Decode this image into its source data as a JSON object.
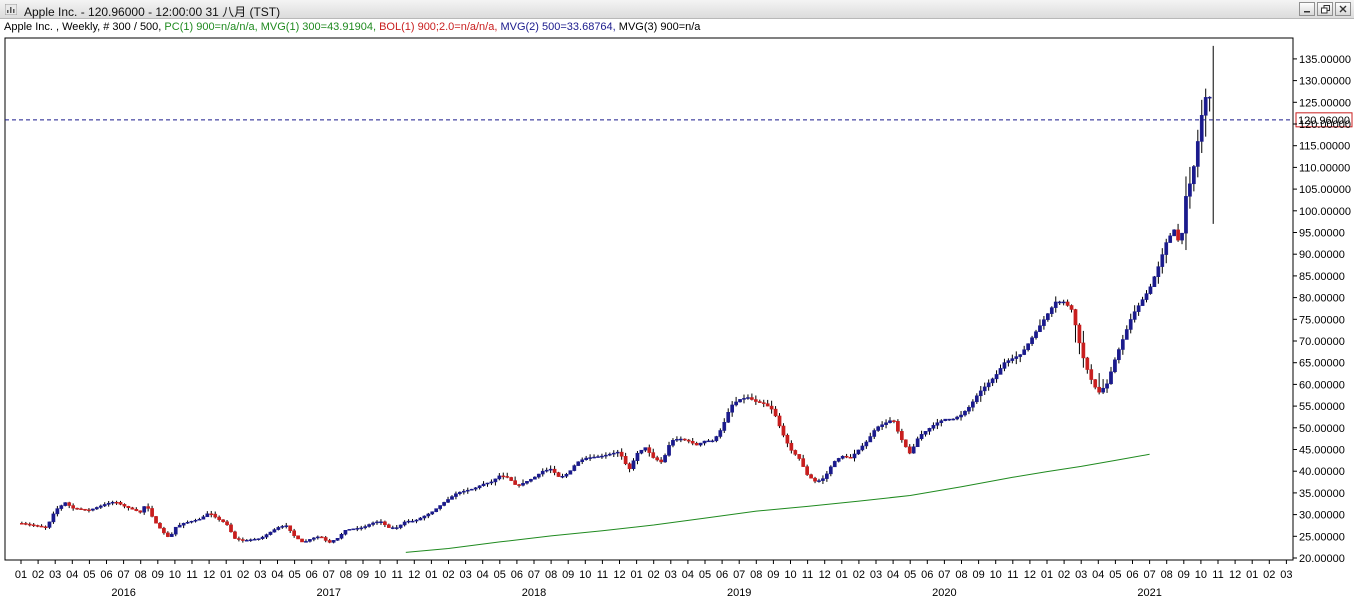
{
  "window": {
    "title": "Apple Inc. - 120.96000 - 12:00:00  31 八月 (TST)",
    "controls": [
      "minimize-icon",
      "restore-icon",
      "close-icon"
    ]
  },
  "infobar": {
    "symbol": "Apple Inc. , Weekly, # 300 / 500, ",
    "pc": "PC(1) 900=n/a/n/a, ",
    "mvg1": "MVG(1) 300=43.91904, ",
    "bol": "BOL(1) 900;2.0=n/a/n/a, ",
    "mvg2": "MVG(2) 500=33.68764, ",
    "mvg3": "MVG(3) 900=n/a"
  },
  "colors": {
    "up": "#1a1a8c",
    "down": "#c81e1e",
    "pc": "#1f8a1f",
    "mvg1": "#1f8a1f",
    "bol": "#c81e1e",
    "mvg2": "#1a1a8c",
    "mvg3": "#000000",
    "grid": "#e2e2e2",
    "current_line": "#1a1a8c",
    "current_box": "#c81e1e"
  },
  "chart_data": {
    "type": "candlestick",
    "current_price": 120.96,
    "current_price_label": "120.96000",
    "y_ticks": [
      "20.00000",
      "25.00000",
      "30.00000",
      "35.00000",
      "40.00000",
      "45.00000",
      "50.00000",
      "55.00000",
      "60.00000",
      "65.00000",
      "70.00000",
      "75.00000",
      "80.00000",
      "85.00000",
      "90.00000",
      "95.00000",
      "100.00000",
      "105.00000",
      "110.00000",
      "115.00000",
      "120.00000",
      "125.00000",
      "130.00000",
      "135.00000"
    ],
    "ylim": [
      19.5,
      139.5
    ],
    "x_month_labels": [
      "01",
      "02",
      "03",
      "04",
      "05",
      "06",
      "07",
      "08",
      "09",
      "10",
      "11",
      "12",
      "01",
      "02",
      "03",
      "04",
      "05",
      "06",
      "07",
      "08",
      "09",
      "10",
      "11",
      "12",
      "01",
      "02",
      "03",
      "04",
      "05",
      "06",
      "07",
      "08",
      "09",
      "10",
      "11",
      "12",
      "01",
      "02",
      "03",
      "04",
      "05",
      "06",
      "07",
      "08",
      "09",
      "10",
      "11",
      "12",
      "01",
      "02",
      "03",
      "04",
      "05",
      "06",
      "07",
      "08",
      "09",
      "10",
      "11",
      "12",
      "01",
      "02",
      "03",
      "04",
      "05",
      "06",
      "07",
      "08",
      "09",
      "10",
      "11",
      "12",
      "01",
      "02",
      "03"
    ],
    "x_year_labels": [
      {
        "label": "2016",
        "month_index": 6
      },
      {
        "label": "2017",
        "month_index": 18
      },
      {
        "label": "2018",
        "month_index": 30
      },
      {
        "label": "2019",
        "month_index": 42
      },
      {
        "label": "2020",
        "month_index": 54
      },
      {
        "label": "2021",
        "month_index": 66
      }
    ],
    "price_path": [
      [
        0,
        28
      ],
      [
        1.5,
        27
      ],
      [
        2,
        31
      ],
      [
        2.6,
        32.8
      ],
      [
        3,
        31.5
      ],
      [
        4,
        31
      ],
      [
        5,
        32.5
      ],
      [
        5.5,
        33
      ],
      [
        6,
        32
      ],
      [
        7,
        30.5
      ],
      [
        7.3,
        32.5
      ],
      [
        7.8,
        28.5
      ],
      [
        8.3,
        26
      ],
      [
        8.7,
        24.5
      ],
      [
        9,
        27
      ],
      [
        9.5,
        28
      ],
      [
        10,
        28.5
      ],
      [
        10.5,
        29
      ],
      [
        11,
        30.5
      ],
      [
        11.5,
        29
      ],
      [
        12,
        28
      ],
      [
        12.5,
        24.5
      ],
      [
        13,
        24
      ],
      [
        14,
        24.5
      ],
      [
        15,
        27
      ],
      [
        15.5,
        27.5
      ],
      [
        16,
        25
      ],
      [
        16.5,
        23.5
      ],
      [
        17,
        24.5
      ],
      [
        17.5,
        25
      ],
      [
        18,
        23.5
      ],
      [
        18.5,
        24.5
      ],
      [
        19,
        26.5
      ],
      [
        20,
        27
      ],
      [
        20.5,
        28
      ],
      [
        21,
        28.5
      ],
      [
        21.5,
        27
      ],
      [
        22,
        27
      ],
      [
        22.5,
        28.5
      ],
      [
        23,
        28.5
      ],
      [
        23.5,
        29.5
      ],
      [
        24,
        30.5
      ],
      [
        24.8,
        33
      ],
      [
        25.5,
        35
      ],
      [
        26.5,
        36
      ],
      [
        27,
        37
      ],
      [
        27.5,
        37.5
      ],
      [
        28,
        39
      ],
      [
        28.5,
        38.5
      ],
      [
        29,
        36.5
      ],
      [
        30,
        38.5
      ],
      [
        30.5,
        40
      ],
      [
        31,
        40.5
      ],
      [
        31.5,
        38.5
      ],
      [
        32,
        39.5
      ],
      [
        32.5,
        42
      ],
      [
        33,
        43
      ],
      [
        34,
        43.5
      ],
      [
        35,
        44.5
      ],
      [
        35.3,
        42
      ],
      [
        35.6,
        40.5
      ],
      [
        36,
        44
      ],
      [
        36.5,
        45.5
      ],
      [
        37,
        43
      ],
      [
        37.5,
        42
      ],
      [
        38,
        47
      ],
      [
        38.5,
        47.5
      ],
      [
        39,
        47
      ],
      [
        39.5,
        46
      ],
      [
        40,
        47
      ],
      [
        40.5,
        47
      ],
      [
        41,
        50
      ],
      [
        41.5,
        55
      ],
      [
        42,
        56.5
      ],
      [
        42.5,
        57
      ],
      [
        43,
        56
      ],
      [
        43.5,
        55.5
      ],
      [
        44,
        54
      ],
      [
        44.5,
        49
      ],
      [
        45,
        45
      ],
      [
        45.5,
        43
      ],
      [
        46,
        39
      ],
      [
        46.5,
        37.5
      ],
      [
        47,
        38.5
      ],
      [
        47.5,
        42
      ],
      [
        48,
        43.5
      ],
      [
        48.5,
        43
      ],
      [
        49,
        45
      ],
      [
        49.5,
        47
      ],
      [
        50,
        50
      ],
      [
        50.5,
        51
      ],
      [
        51,
        52
      ],
      [
        51.3,
        49
      ],
      [
        51.6,
        46.5
      ],
      [
        52,
        44
      ],
      [
        52.5,
        48
      ],
      [
        53,
        49.5
      ],
      [
        53.5,
        51
      ],
      [
        54,
        52
      ],
      [
        54.5,
        52
      ],
      [
        55,
        53
      ],
      [
        55.5,
        55
      ],
      [
        56,
        58
      ],
      [
        56.5,
        60
      ],
      [
        57,
        62
      ],
      [
        57.5,
        65
      ],
      [
        58,
        66
      ],
      [
        58.5,
        67
      ],
      [
        59,
        70
      ],
      [
        59.5,
        73
      ],
      [
        60,
        76
      ],
      [
        60.5,
        79
      ],
      [
        61,
        79
      ],
      [
        61.5,
        77
      ],
      [
        61.8,
        71
      ],
      [
        62.2,
        65
      ],
      [
        62.6,
        61
      ],
      [
        63,
        58
      ],
      [
        63.5,
        60
      ],
      [
        64,
        66
      ],
      [
        64.5,
        71
      ],
      [
        65,
        76
      ],
      [
        65.5,
        79
      ],
      [
        66,
        82
      ],
      [
        66.5,
        87
      ],
      [
        67,
        93
      ],
      [
        67.5,
        96
      ],
      [
        67.8,
        91
      ],
      [
        68.1,
        103
      ],
      [
        68.5,
        108
      ],
      [
        68.9,
        118
      ],
      [
        69.2,
        126
      ],
      [
        69.5,
        126.5
      ],
      [
        69.7,
        120.96
      ]
    ],
    "series": [
      {
        "name": "MVG(1)",
        "values": [
          [
            22.5,
            21.3
          ],
          [
            25,
            22.2
          ],
          [
            28,
            23.7
          ],
          [
            31,
            25.1
          ],
          [
            34,
            26.3
          ],
          [
            37,
            27.6
          ],
          [
            40,
            29.2
          ],
          [
            43,
            30.8
          ],
          [
            46,
            31.9
          ],
          [
            49,
            33.1
          ],
          [
            52,
            34.4
          ],
          [
            55,
            36.4
          ],
          [
            58,
            38.6
          ],
          [
            60,
            39.9
          ],
          [
            62,
            41.1
          ],
          [
            64,
            42.5
          ],
          [
            66,
            43.9
          ]
        ]
      }
    ]
  }
}
